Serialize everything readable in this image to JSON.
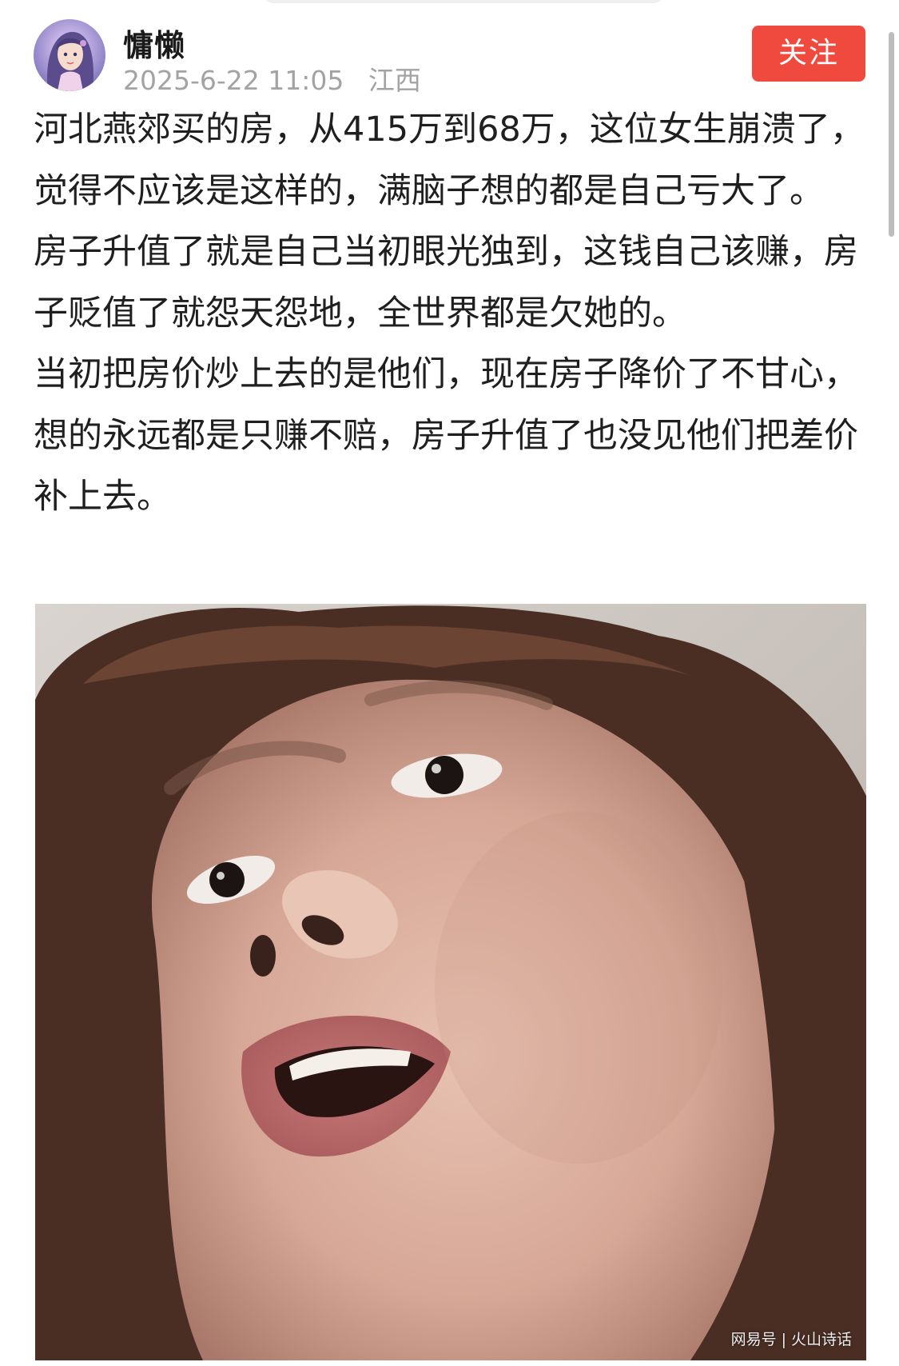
{
  "post": {
    "author": "慵懒",
    "date": "2025-6-22 11:05",
    "location": "江西",
    "follow_label": "关注",
    "paragraphs": [
      "河北燕郊买的房，从415万到68万，这位女生崩溃了，觉得不应该是这样的，满脑子想的都是自己亏大了。",
      "房子升值了就是自己当初眼光独到，这钱自己该赚，房子贬值了就怨天怨地，全世界都是欠她的。",
      "当初把房价炒上去的是他们，现在房子降价了不甘心，想的永远都是只赚不赔，房子升值了也没见他们把差价补上去。"
    ]
  },
  "watermark": {
    "platform": "网易号",
    "separator": "|",
    "account": "火山诗话"
  },
  "icons": {
    "avatar": "anime-girl-avatar",
    "photo": "close-up-woman-face-photo"
  },
  "colors": {
    "follow_button": "#f04a3e",
    "meta_text": "#a3a3a3",
    "body_text": "#1f1f1f"
  }
}
